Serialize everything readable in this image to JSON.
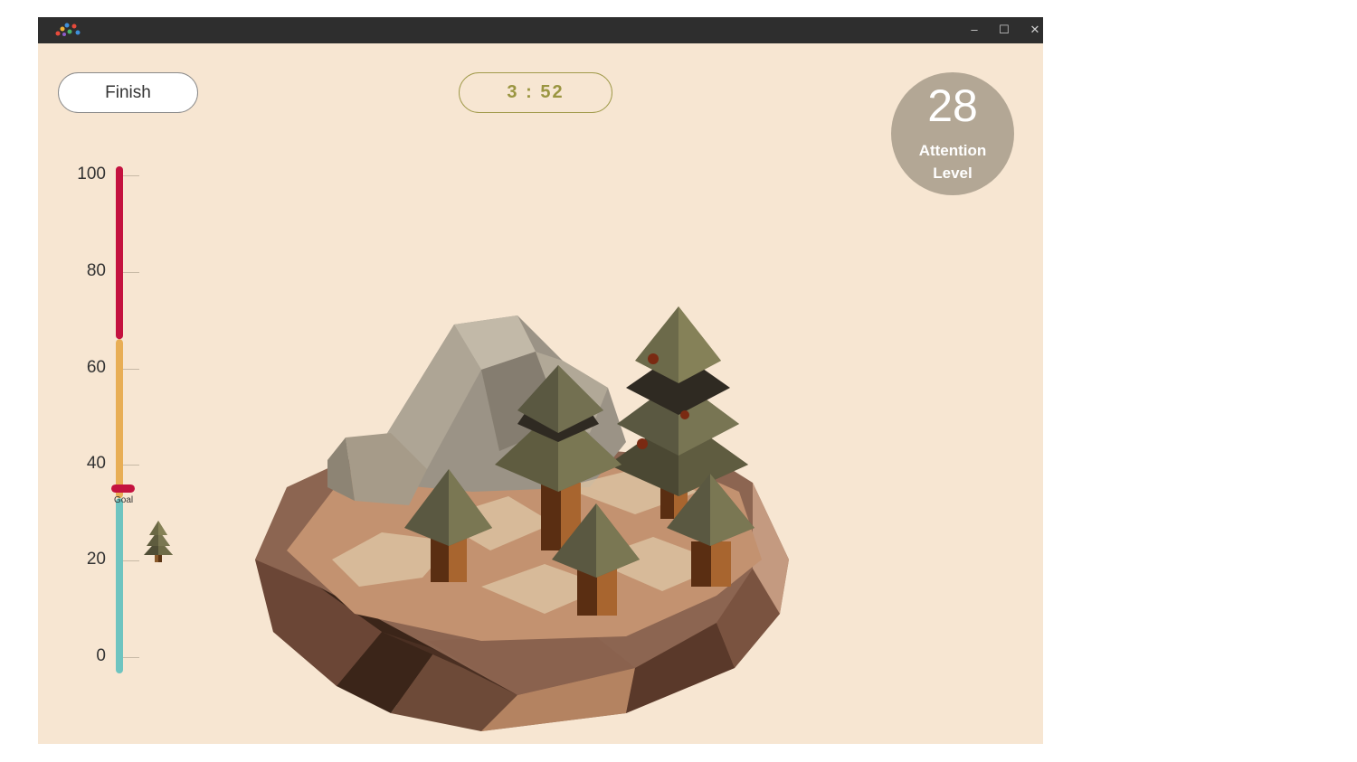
{
  "window": {
    "controls": {
      "minimize": "–",
      "maximize": "☐",
      "close": "✕"
    }
  },
  "header": {
    "finish_label": "Finish",
    "timer": "3 : 52"
  },
  "attention": {
    "value": "28",
    "label": "Attention Level"
  },
  "meter": {
    "ticks": [
      "100",
      "80",
      "60",
      "40",
      "20",
      "0"
    ],
    "goal_label": "Goal",
    "goal_value": 35,
    "zones": [
      {
        "from": 0,
        "to": 33,
        "color": "#6ec4c0"
      },
      {
        "from": 33,
        "to": 66,
        "color": "#e8ae55"
      },
      {
        "from": 66,
        "to": 100,
        "color": "#c4123f"
      }
    ]
  },
  "colors": {
    "background": "#f7e6d2",
    "titlebar": "#2e2e2e",
    "goal_marker": "#c4123f",
    "timer_text": "#9a9540",
    "attention_circle": "#b3a795"
  },
  "icons": {
    "app": "app-logo-icon",
    "mini_tree": "tree-icon"
  }
}
